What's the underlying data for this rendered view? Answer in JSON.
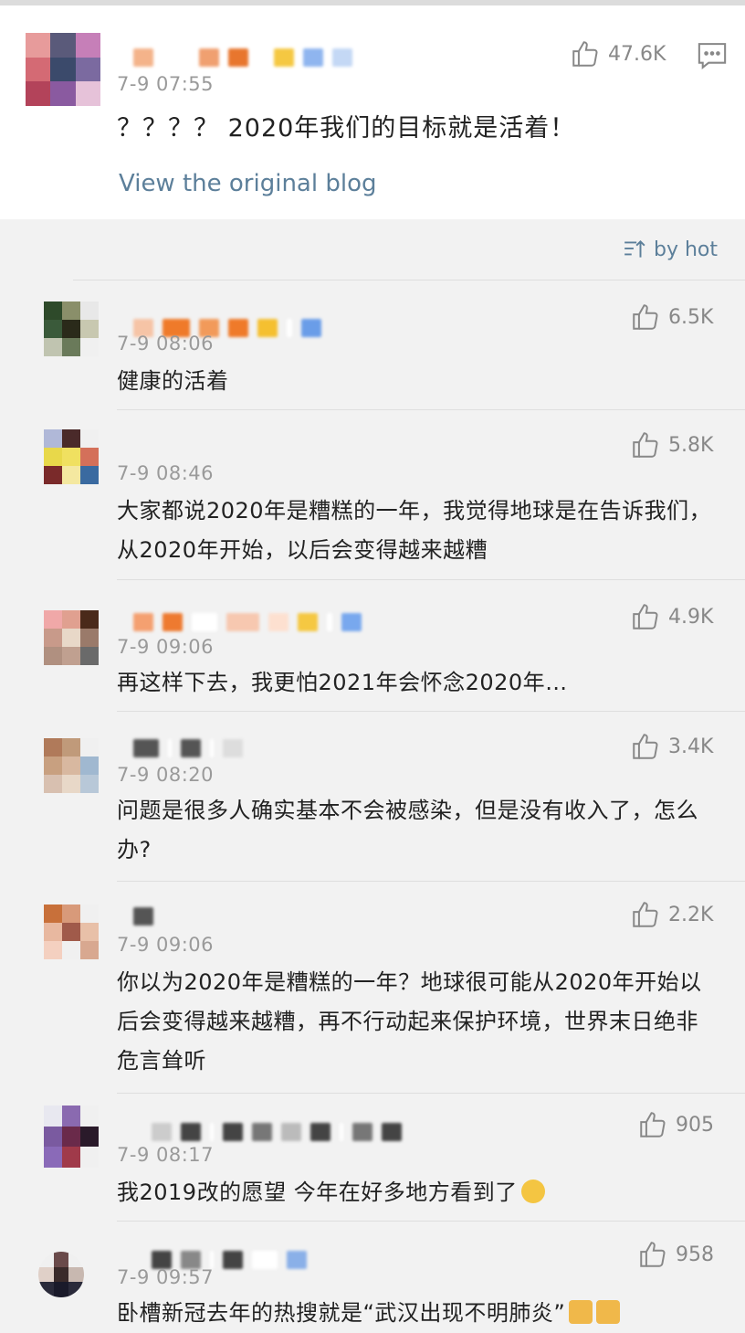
{
  "post": {
    "time": "7-9 07:55",
    "text": "？？？？ 2020年我们的目标就是活着！",
    "view_link": "View the original blog",
    "likes": "47.6K"
  },
  "sort": {
    "label": "by hot"
  },
  "comments": [
    {
      "time": "7-9 08:06",
      "text": "健康的活着",
      "likes": "6.5K"
    },
    {
      "time": "7-9 08:46",
      "text": "大家都说2020年是糟糕的一年，我觉得地球是在告诉我们，从2020年开始，以后会变得越来越糟",
      "likes": "5.8K"
    },
    {
      "time": "7-9 09:06",
      "text": "再这样下去，我更怕2021年会怀念2020年…",
      "likes": "4.9K"
    },
    {
      "time": "7-9 08:20",
      "text": "问题是很多人确实基本不会被感染，但是没有收入了，怎么办?",
      "likes": "3.4K"
    },
    {
      "time": "7-9 09:06",
      "text": "你以为2020年是糟糕的一年？地球很可能从2020年开始以后会变得越来越糟，再不行动起来保护环境，世界末日绝非危言耸听",
      "likes": "2.2K"
    },
    {
      "time": "7-9 08:17",
      "text": "我2019改的愿望 今年在好多地方看到了",
      "likes": "905"
    },
    {
      "time": "7-9 09:57",
      "text": "卧槽新冠去年的热搜就是“武汉出现不明肺炎”",
      "likes": "958"
    }
  ],
  "colors": {
    "link": "#5c7f9a",
    "meta": "#9a9a9a",
    "background": "#f2f2f2"
  }
}
